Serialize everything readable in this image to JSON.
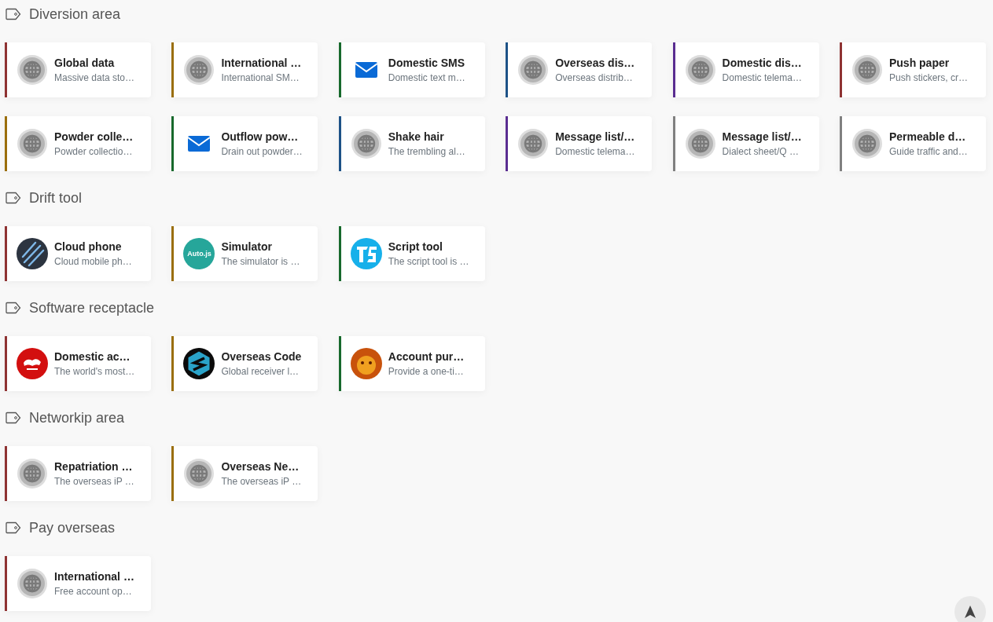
{
  "sections": [
    {
      "title": "Diversion area",
      "cards": [
        {
          "title": "Global data",
          "description": "Massive data sto…",
          "color": "#8e3232",
          "kind": "globe"
        },
        {
          "title": "International …",
          "description": "International SM…",
          "color": "#9a6e0c",
          "kind": "globe"
        },
        {
          "title": "Domestic SMS",
          "description": "Domestic text m…",
          "color": "#17692c",
          "kind": "mail"
        },
        {
          "title": "Overseas dis…",
          "description": "Overseas distrib…",
          "color": "#1d5287",
          "kind": "globe"
        },
        {
          "title": "Domestic dis…",
          "description": "Domestic telema…",
          "color": "#5a2d91",
          "kind": "globe"
        },
        {
          "title": "Push paper",
          "description": "Push stickers, cr…",
          "color": "#8e3232",
          "kind": "globe"
        },
        {
          "title": "Powder colle…",
          "description": "Powder collectio…",
          "color": "#9a6e0c",
          "kind": "globe"
        },
        {
          "title": "Outflow pow…",
          "description": "Drain out powder…",
          "color": "#17692c",
          "kind": "mail"
        },
        {
          "title": "Shake hair",
          "description": "The trembling al…",
          "color": "#1d5287",
          "kind": "globe"
        },
        {
          "title": "Message list/…",
          "description": "Domestic telema…",
          "color": "#5a2d91",
          "kind": "globe"
        },
        {
          "title": "Message list/…",
          "description": "Dialect sheet/Q …",
          "color": "#808080",
          "kind": "globe"
        },
        {
          "title": "Permeable d…",
          "description": "Guide traffic and…",
          "color": "#808080",
          "kind": "globe"
        }
      ]
    },
    {
      "title": "Drift tool",
      "cards": [
        {
          "title": "Cloud phone",
          "description": "Cloud mobile ph…",
          "color": "#8e3232",
          "kind": "claw"
        },
        {
          "title": "Simulator",
          "description": "The simulator is …",
          "color": "#9a6e0c",
          "kind": "badge",
          "icon_text": "Auto.js"
        },
        {
          "title": "Script tool",
          "description": "The script tool is …",
          "color": "#17692c",
          "kind": "ts"
        }
      ]
    },
    {
      "title": "Software receptacle",
      "cards": [
        {
          "title": "Domestic ac…",
          "description": "The world's most…",
          "color": "#8e3232",
          "kind": "tiger"
        },
        {
          "title": "Overseas Code",
          "description": "Global receiver l…",
          "color": "#9a6e0c",
          "kind": "hexagon"
        },
        {
          "title": "Account pur…",
          "description": "Provide a one-ti…",
          "color": "#17692c",
          "kind": "photo"
        }
      ]
    },
    {
      "title": "Networkip area",
      "cards": [
        {
          "title": "Repatriation …",
          "description": "The overseas iP …",
          "color": "#8e3232",
          "kind": "globe"
        },
        {
          "title": "Overseas Ne…",
          "description": "The overseas iP …",
          "color": "#9a6e0c",
          "kind": "globe"
        }
      ]
    },
    {
      "title": "Pay overseas",
      "cards": [
        {
          "title": "International …",
          "description": "Free account op…",
          "color": "#8e3232",
          "kind": "globe"
        }
      ]
    }
  ]
}
